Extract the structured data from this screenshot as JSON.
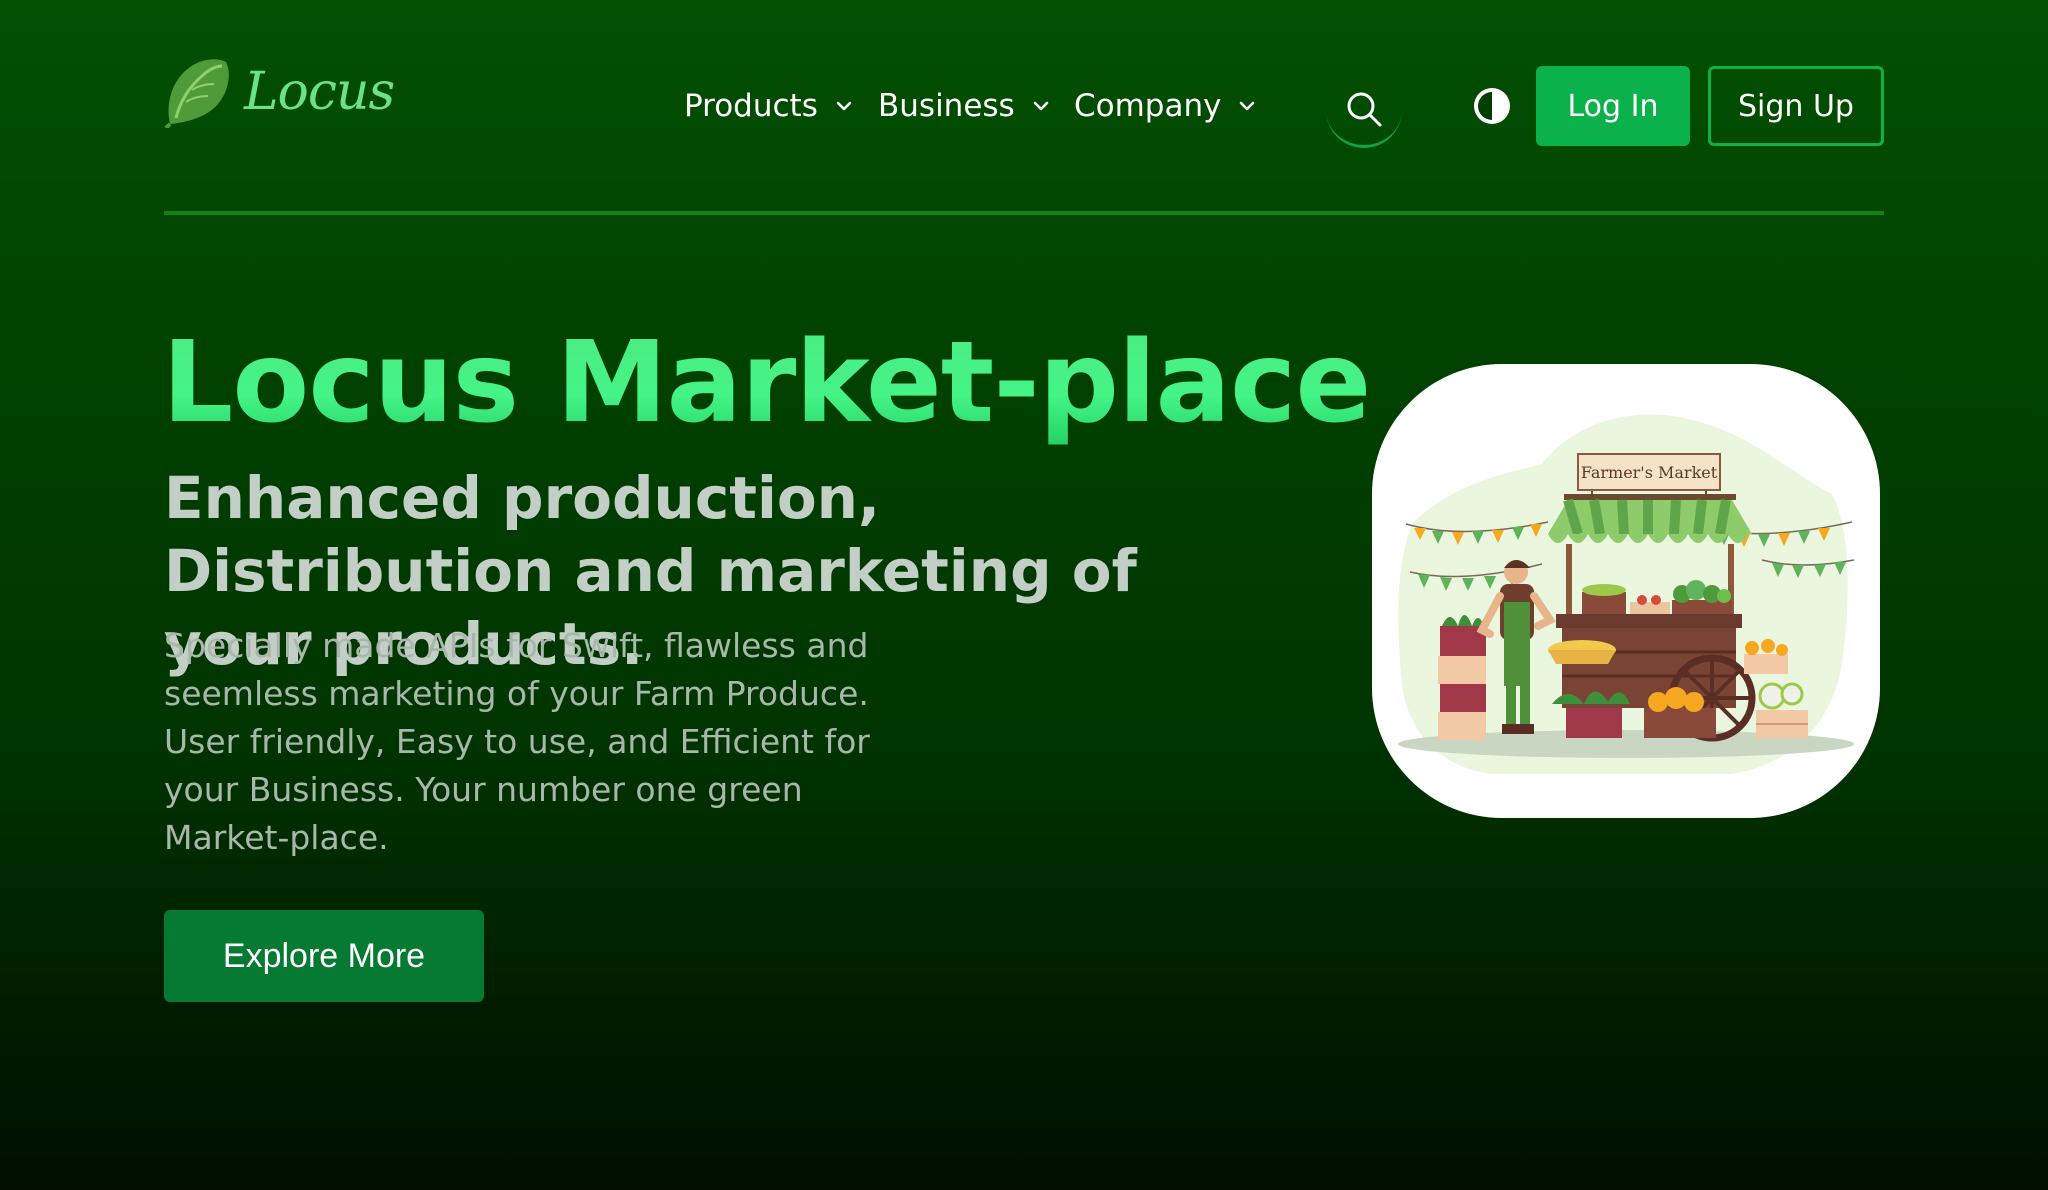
{
  "brand": {
    "name": "Locus"
  },
  "nav": {
    "items": [
      {
        "label": "Products"
      },
      {
        "label": "Business"
      },
      {
        "label": "Company"
      }
    ],
    "login_label": "Log In",
    "signup_label": "Sign Up"
  },
  "hero": {
    "title": "Locus Market-place",
    "subtitle": "Enhanced production, Distribution and marketing of your products.",
    "description": "Specially made APIs for Swift, flawless and seemless marketing of your Farm Produce. User friendly, Easy to use, and Efficient for your Business. Your number one green Market-place.",
    "cta_label": "Explore More"
  },
  "illustration": {
    "sign_text": "Farmer's Market"
  },
  "icons": {
    "logo": "lettuce-leaf-icon",
    "dropdown": "chevron-down-icon",
    "search": "search-icon",
    "theme": "contrast-icon"
  },
  "colors": {
    "background": "#003f00",
    "accent": "#0bb14a",
    "title_gradient": "#45f486",
    "cta": "#067a32",
    "divider": "#11821e"
  }
}
